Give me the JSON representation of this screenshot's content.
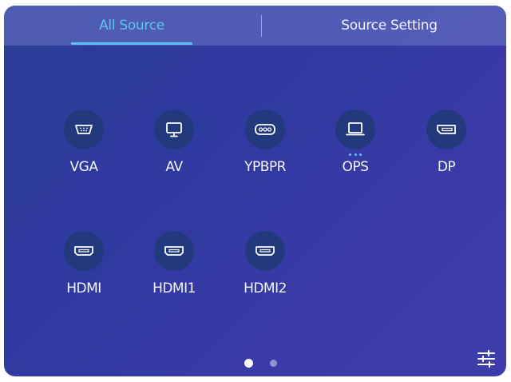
{
  "tabs": [
    {
      "label": "All Source",
      "active": true
    },
    {
      "label": "Source Setting",
      "active": false
    }
  ],
  "sources": [
    {
      "label": "VGA",
      "icon": "vga-port-icon"
    },
    {
      "label": "AV",
      "icon": "monitor-icon"
    },
    {
      "label": "YPBPR",
      "icon": "component-port-icon"
    },
    {
      "label": "OPS",
      "icon": "laptop-icon",
      "active": true
    },
    {
      "label": "DP",
      "icon": "displayport-icon"
    },
    {
      "label": "HDMI",
      "icon": "hdmi-port-icon"
    },
    {
      "label": "HDMI1",
      "icon": "hdmi-port-icon"
    },
    {
      "label": "HDMI2",
      "icon": "hdmi-port-icon"
    }
  ],
  "pager": {
    "current_page": 1,
    "page_count": 2
  },
  "colors": {
    "accent": "#59c4f5",
    "icon_circle": "#223a7d",
    "panel_gradient_start": "#2b3c96",
    "panel_gradient_end": "#3d3cab"
  },
  "settings_icon": "sliders-icon"
}
